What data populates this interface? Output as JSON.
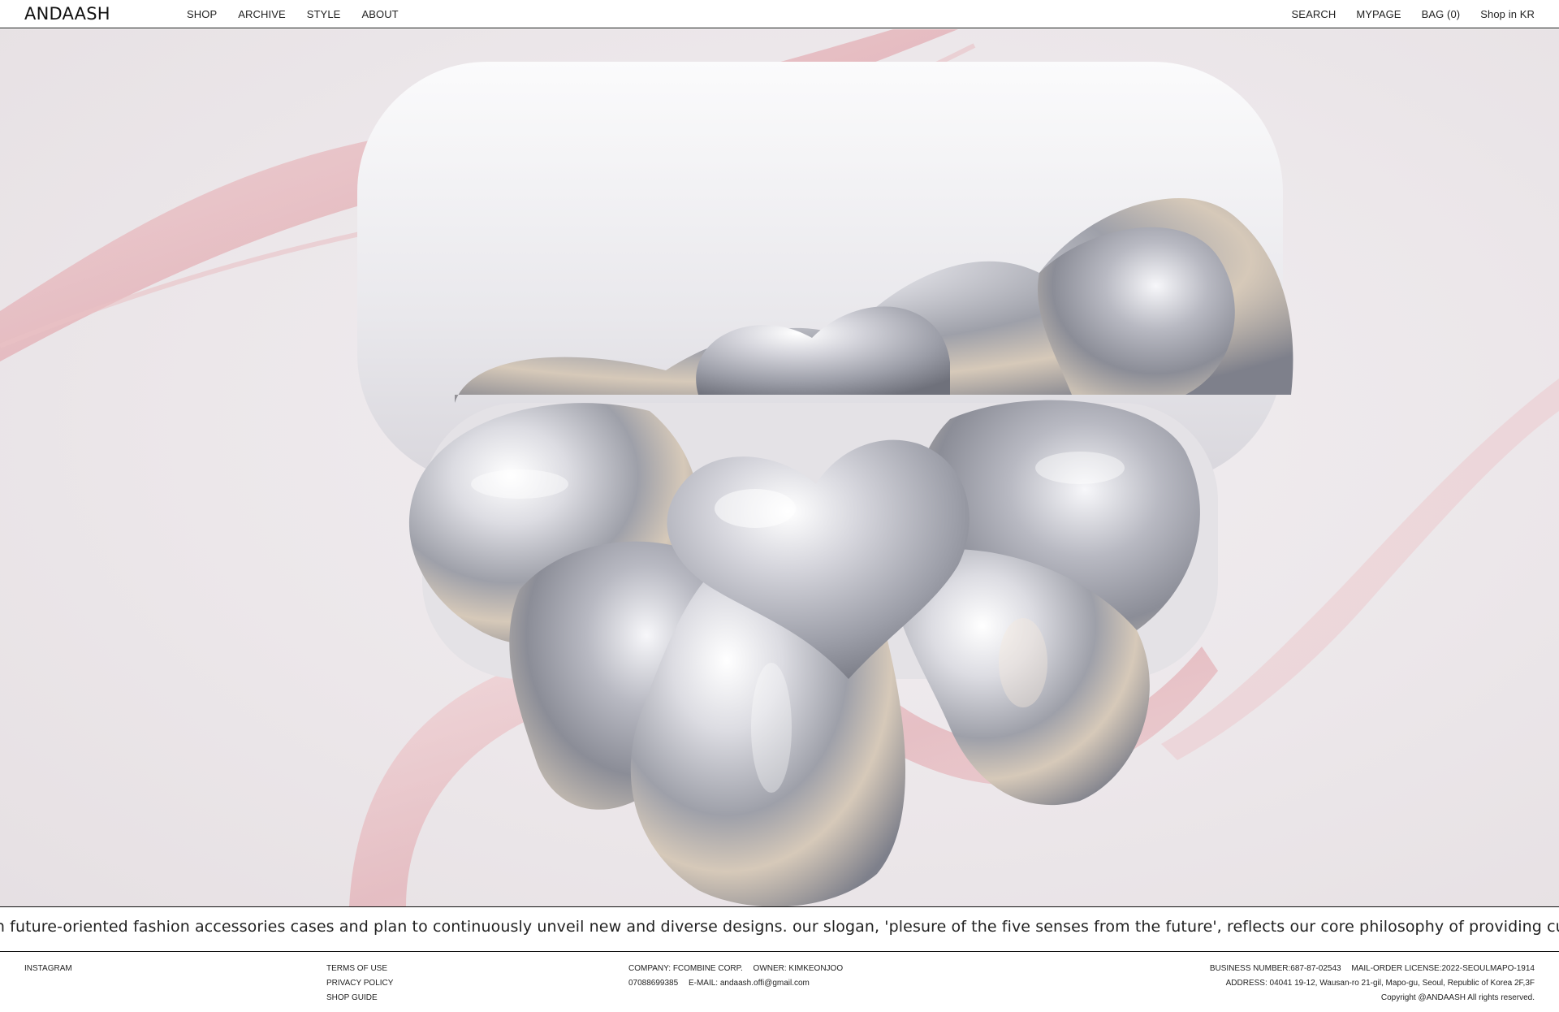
{
  "header": {
    "logo": "ANDAASH",
    "nav_left": [
      "SHOP",
      "ARCHIVE",
      "STYLE",
      "ABOUT"
    ],
    "nav_right": [
      "SEARCH",
      "MYPAGE",
      "BAG (0)",
      "Shop in KR"
    ]
  },
  "hero": {
    "image": "chrome-bow-airpods-case",
    "colors": {
      "background": "#ece7ea",
      "ribbon": "#e8b8bd",
      "chrome": "#b9b9c0",
      "case": "#f2f1f3"
    }
  },
  "marquee": {
    "text": "alize in future-oriented fashion accessories cases and plan to continuously unveil new and diverse designs. our slogan, 'plesure of the five senses from the future', reflects our core philosophy of providing customers with uniqu"
  },
  "footer": {
    "instagram": "INSTAGRAM",
    "terms": "TERMS OF USE",
    "privacy": "PRIVACY POLICY",
    "guide": "SHOP GUIDE",
    "company": "COMPANY: FCOMBINE CORP.",
    "owner": "OWNER: KIMKEONJOO",
    "phone": "07088699385",
    "email": "E-MAIL: andaash.offi@gmail.com",
    "business": "BUSINESS NUMBER:687-87-02543",
    "license": "MAIL-ORDER LICENSE:2022-SEOULMAPO-1914",
    "address": "ADDRESS: 04041 19-12, Wausan-ro 21-gil, Mapo-gu, Seoul, Republic of Korea 2F,3F",
    "copyright": "Copyright @ANDAASH All rights reserved."
  }
}
